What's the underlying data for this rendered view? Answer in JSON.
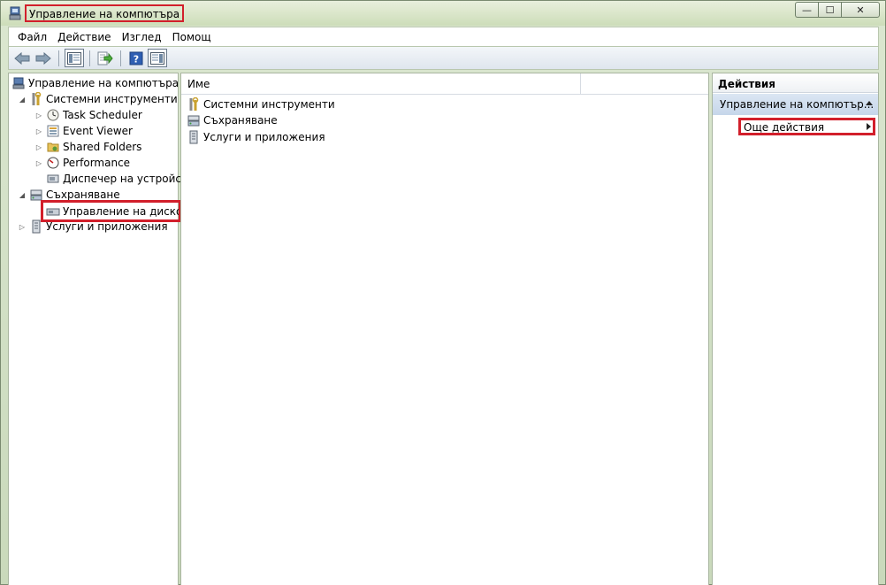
{
  "window": {
    "title": "Управление на компютъра",
    "controls": {
      "minimize": "—",
      "maximize": "☐",
      "close": "✕"
    }
  },
  "menu": {
    "items": [
      "Файл",
      "Действие",
      "Изглед",
      "Помощ"
    ]
  },
  "toolbar": {
    "icons": [
      "back-arrow-icon",
      "forward-arrow-icon",
      "show-hide-console-tree-icon",
      "export-list-icon",
      "help-icon",
      "show-hide-action-pane-icon"
    ]
  },
  "tree": {
    "root": "Управление на компютъра (л",
    "system_tools": "Системни инструменти",
    "task_scheduler": "Task Scheduler",
    "event_viewer": "Event Viewer",
    "shared_folders": "Shared Folders",
    "performance": "Performance",
    "device_manager": "Диспечер на устройст",
    "storage": "Съхраняване",
    "disk_management": "Управление на дисков",
    "services_apps": "Услуги и приложения"
  },
  "center": {
    "column_name": "Име",
    "rows": [
      "Системни инструменти",
      "Съхраняване",
      "Услуги и приложения"
    ]
  },
  "actions": {
    "header": "Действия",
    "section": "Управление на компютър...",
    "more_actions": "Още действия"
  },
  "colors": {
    "highlight": "#d21f2b",
    "section_bg": "#c6d6ea"
  }
}
